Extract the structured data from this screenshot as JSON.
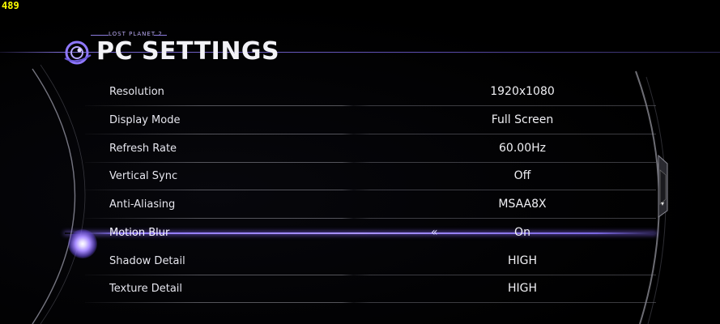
{
  "hud": {
    "fps": "489"
  },
  "header": {
    "game_title": "LOST PLANET 2",
    "title": "PC SETTINGS"
  },
  "settings": [
    {
      "label": "Resolution",
      "value": "1920x1080"
    },
    {
      "label": "Display Mode",
      "value": "Full Screen"
    },
    {
      "label": "Refresh Rate",
      "value": "60.00Hz"
    },
    {
      "label": "Vertical Sync",
      "value": "Off"
    },
    {
      "label": "Anti-Aliasing",
      "value": "MSAA8X"
    },
    {
      "label": "Motion Blur",
      "value": "On",
      "selected": true
    },
    {
      "label": "Shadow Detail",
      "value": "HIGH"
    },
    {
      "label": "Texture Detail",
      "value": "HIGH"
    }
  ],
  "icons": {
    "logo": "ringed-planet-logo-icon",
    "selector": "left-chevron-icon",
    "cursor": "glowing-orb-icon",
    "scroll": "scroll-down-arrow-icon"
  },
  "colors": {
    "accent": "#8f78ff",
    "fps": "#ffff00",
    "background": "#000000"
  }
}
